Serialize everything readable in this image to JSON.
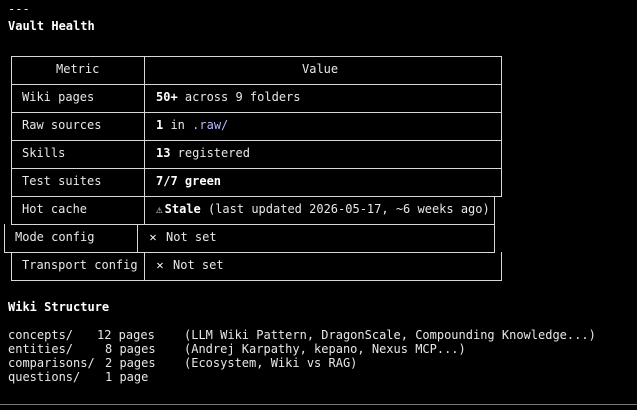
{
  "top_rule": "---",
  "vault_title": "Vault Health",
  "table": {
    "headers": [
      "Metric",
      "Value"
    ],
    "rows": [
      {
        "metric": "Wiki pages",
        "value_bold": "50+",
        "value_rest": " across 9 folders"
      },
      {
        "metric": "Raw sources",
        "value_bold": "1",
        "value_rest": " in ",
        "value_path": ".raw/"
      },
      {
        "metric": "Skills",
        "value_bold": "13",
        "value_rest": " registered"
      },
      {
        "metric": "Test suites",
        "value_bold": "7/7 green",
        "value_rest": ""
      },
      {
        "metric": "Hot cache",
        "icon": "warning-icon",
        "value_bold": "Stale",
        "value_rest": " (last updated 2026-05-17, ~6 weeks ago)"
      },
      {
        "metric": "Mode config",
        "icon": "x-icon",
        "value_rest": "Not set"
      },
      {
        "metric": "Transport config",
        "icon": "x-icon",
        "value_rest": "Not set"
      }
    ]
  },
  "structure_title": "Wiki Structure",
  "structure": [
    {
      "folder": "concepts/",
      "count": "12 pages",
      "desc": "(LLM Wiki Pattern, DragonScale, Compounding Knowledge...)"
    },
    {
      "folder": "entities/",
      "count": "8 pages",
      "desc": "(Andrej Karpathy, kepano, Nexus MCP...)"
    },
    {
      "folder": "comparisons/",
      "count": "2 pages",
      "desc": "(Ecosystem, Wiki vs RAG)"
    },
    {
      "folder": "questions/",
      "count": "1 page",
      "desc": ""
    }
  ],
  "icons": {
    "warning": "⚠",
    "x": "✕"
  }
}
